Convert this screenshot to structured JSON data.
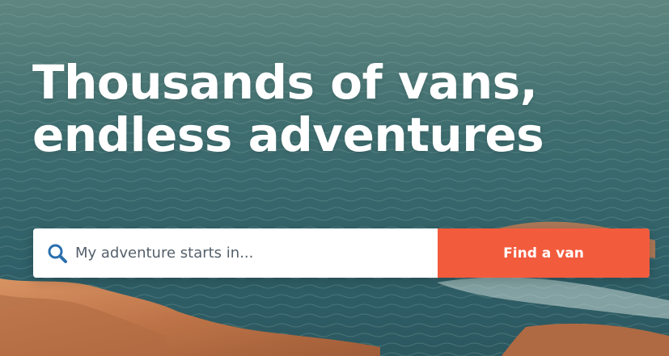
{
  "hero": {
    "headline_line1": "Thousands of vans,",
    "headline_line2": "endless adventures",
    "background_image": "ocean-coastline-photo"
  },
  "search": {
    "placeholder": "My adventure starts in...",
    "value": "",
    "icon": "search-icon",
    "button_label": "Find a van"
  },
  "colors": {
    "accent": "#f35b3d",
    "icon": "#2a6fae",
    "sea": "#3f6f74",
    "rock": "#c27a4e"
  }
}
